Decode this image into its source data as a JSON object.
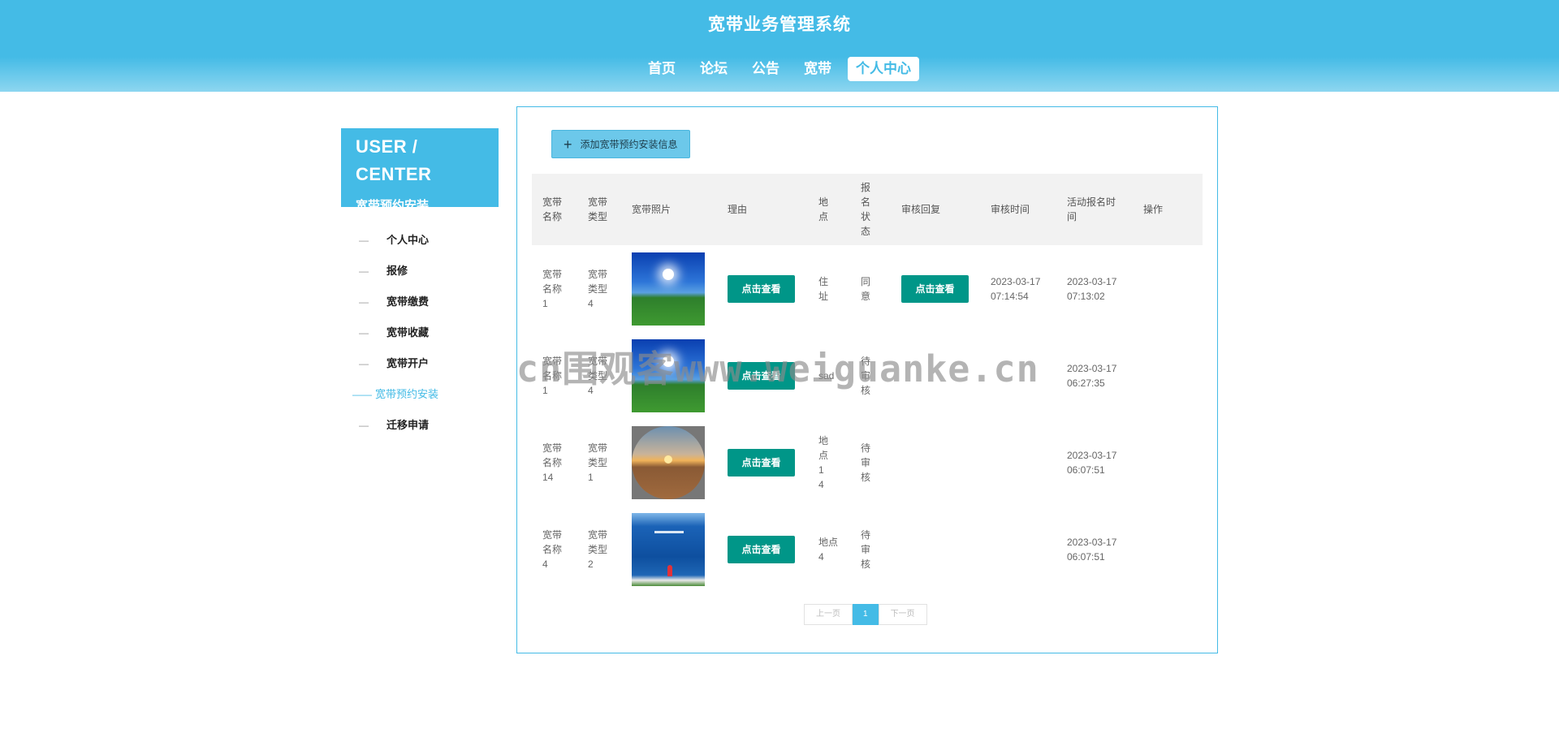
{
  "header": {
    "title": "宽带业务管理系统",
    "nav": [
      "首页",
      "论坛",
      "公告",
      "宽带",
      "个人中心"
    ],
    "active_nav": "个人中心"
  },
  "sidebar": {
    "title_en": "USER / CENTER",
    "title_cn": "宽带预约安装",
    "items": [
      {
        "dash": "—",
        "label": "个人中心"
      },
      {
        "dash": "—",
        "label": "报修"
      },
      {
        "dash": "—",
        "label": "宽带缴费"
      },
      {
        "dash": "—",
        "label": "宽带收藏"
      },
      {
        "dash": "—",
        "label": "宽带开户"
      },
      {
        "dash": "——",
        "label": "宽带预约安装"
      },
      {
        "dash": "—",
        "label": "迁移申请"
      }
    ]
  },
  "main": {
    "add_button": "添加宽带预约安装信息",
    "add_icon": "plus-icon",
    "columns": [
      "宽带名称",
      "宽带类型",
      "宽带照片",
      "理由",
      "地点",
      "报名状态",
      "审核回复",
      "审核时间",
      "活动报名时间",
      "操作"
    ],
    "rows": [
      {
        "name": "宽带名称1",
        "type": "宽带类型4",
        "photo": "sky-field",
        "reason_btn": "点击查看",
        "place": "住址",
        "status": "同意",
        "reply_btn": "点击查看",
        "review_time": "2023-03-17 07:14:54",
        "apply_time": "2023-03-17 07:13:02",
        "ops": ""
      },
      {
        "name": "宽带名称1",
        "type": "宽带类型4",
        "photo": "sky-field",
        "reason_btn": "点击查看",
        "place": "sad",
        "status": "待审核",
        "reply_btn": "",
        "review_time": "",
        "apply_time": "2023-03-17 06:27:35",
        "ops": ""
      },
      {
        "name": "宽带名称14",
        "type": "宽带类型1",
        "photo": "sunset-dune",
        "reason_btn": "点击查看",
        "place": "地点14",
        "status": "待审核",
        "reply_btn": "",
        "review_time": "",
        "apply_time": "2023-03-17 06:07:51",
        "ops": ""
      },
      {
        "name": "宽带名称4",
        "type": "宽带类型2",
        "photo": "ocean-figure",
        "reason_btn": "点击查看",
        "place": "地点4",
        "status": "待审核",
        "reply_btn": "",
        "review_time": "",
        "apply_time": "2023-03-17 06:07:51",
        "ops": ""
      }
    ]
  },
  "pagination": {
    "prev": "上一页",
    "current": "1",
    "next": "下一页"
  },
  "watermark": "cn围观客www.weiguanke.cn",
  "colors": {
    "primary": "#44bbe6",
    "button_green": "#009688"
  }
}
